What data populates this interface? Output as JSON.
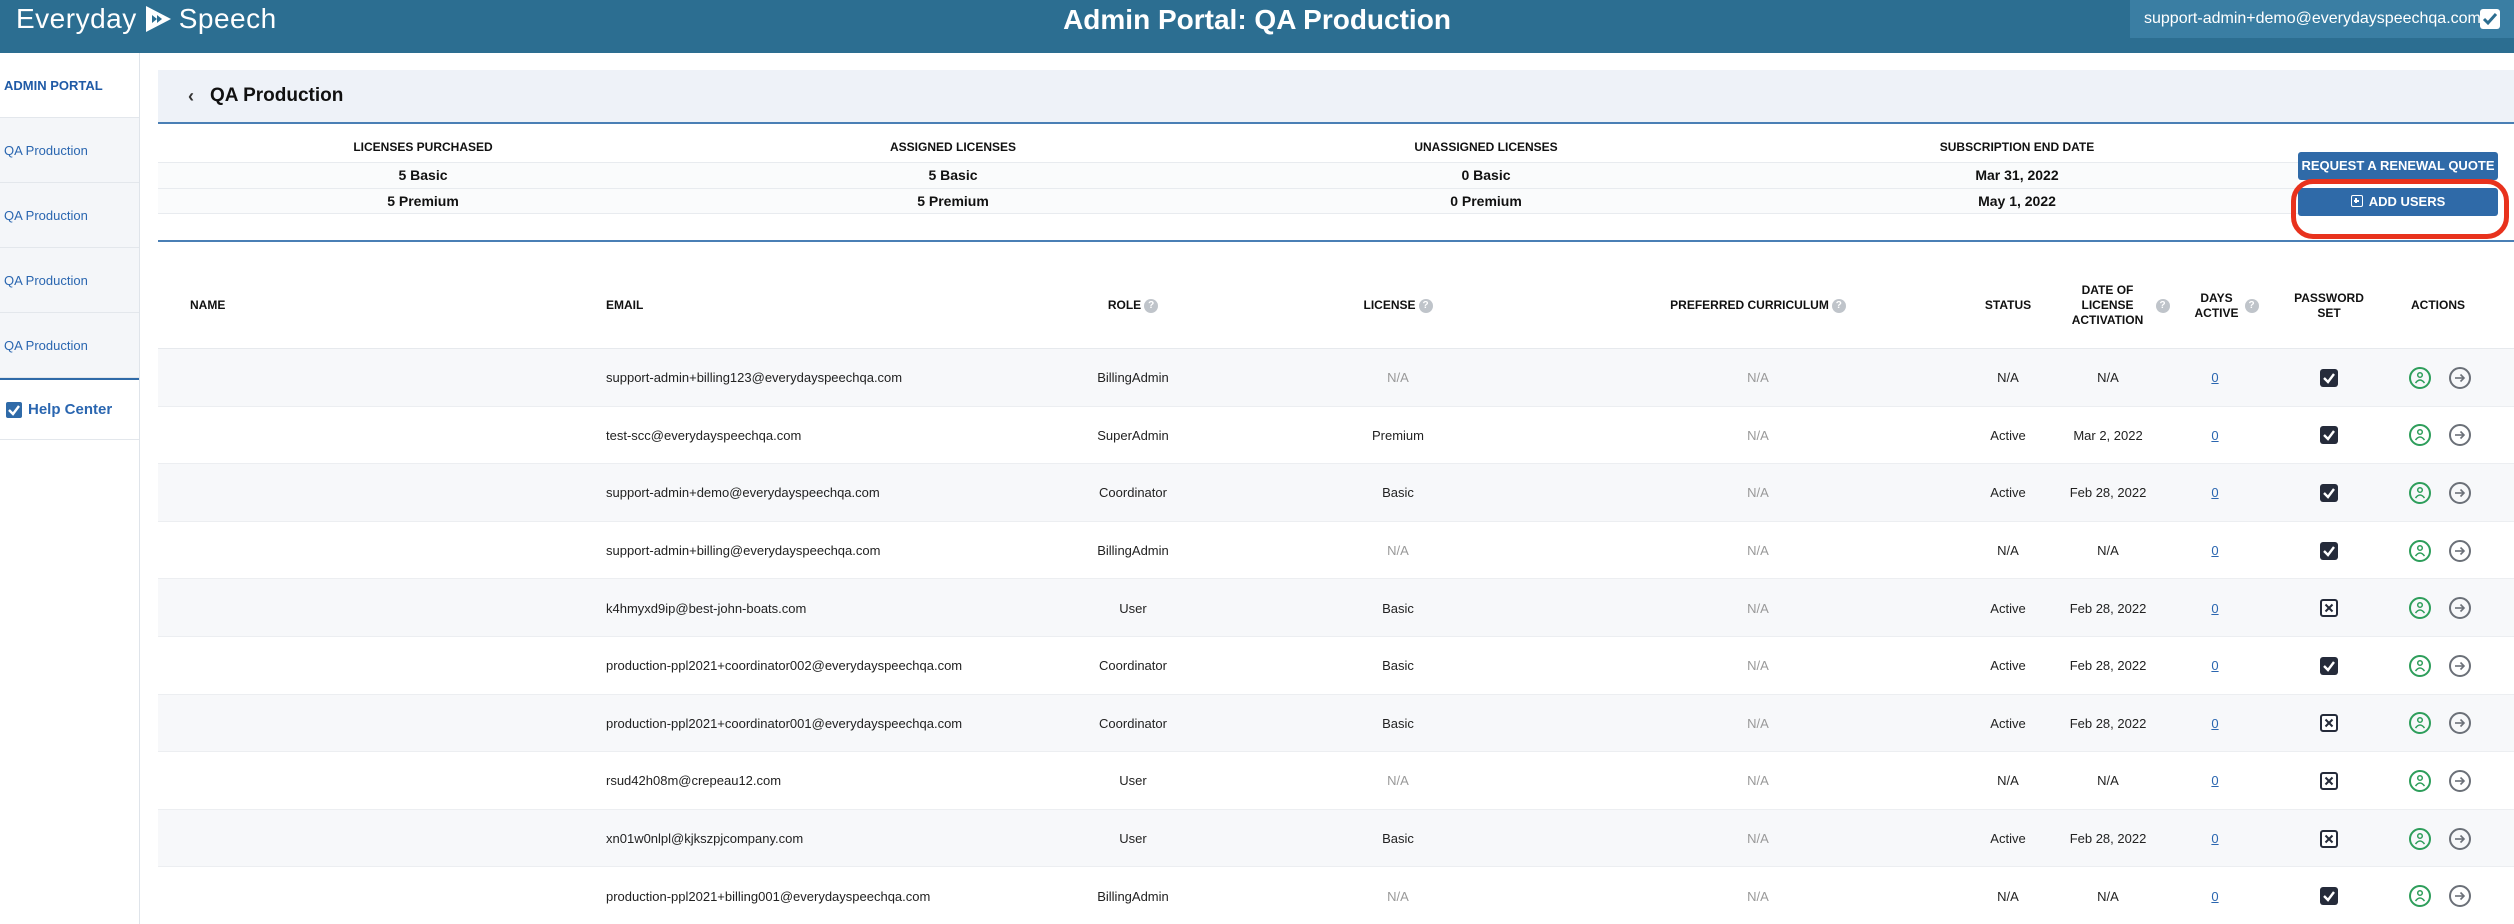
{
  "header": {
    "logo_left": "Everyday",
    "logo_right": "Speech",
    "title": "Admin Portal: QA Production",
    "user_email": "support-admin+demo@everydayspeechqa.com"
  },
  "sidebar": {
    "items": [
      {
        "label": "ADMIN PORTAL"
      },
      {
        "label": "QA Production"
      },
      {
        "label": "QA Production"
      },
      {
        "label": "QA Production"
      },
      {
        "label": "QA Production"
      }
    ],
    "help": "Help Center"
  },
  "page": {
    "title": "QA Production"
  },
  "summary": {
    "headers": [
      "LICENSES PURCHASED",
      "ASSIGNED LICENSES",
      "UNASSIGNED LICENSES",
      "SUBSCRIPTION END DATE"
    ],
    "row1": [
      "5 Basic",
      "5 Basic",
      "0 Basic",
      "Mar 31, 2022"
    ],
    "row2": [
      "5 Premium",
      "5 Premium",
      "0 Premium",
      "May 1, 2022"
    ],
    "renew_label": "REQUEST A RENEWAL QUOTE",
    "add_label": "ADD USERS"
  },
  "table": {
    "headers": {
      "name": "NAME",
      "email": "EMAIL",
      "role": "ROLE",
      "license": "LICENSE",
      "curriculum": "PREFERRED CURRICULUM",
      "status": "STATUS",
      "activation": "DATE OF LICENSE ACTIVATION",
      "days": "DAYS ACTIVE",
      "password": "PASSWORD SET",
      "actions": "ACTIONS",
      "help_mark": "?"
    },
    "rows": [
      {
        "email": "support-admin+billing123@everydayspeechqa.com",
        "role": "BillingAdmin",
        "license": "N/A",
        "curriculum": "N/A",
        "status": "N/A",
        "activation": "N/A",
        "days": "0",
        "password": true
      },
      {
        "email": "test-scc@everydayspeechqa.com",
        "role": "SuperAdmin",
        "license": "Premium",
        "curriculum": "N/A",
        "status": "Active",
        "activation": "Mar 2, 2022",
        "days": "0",
        "password": true
      },
      {
        "email": "support-admin+demo@everydayspeechqa.com",
        "role": "Coordinator",
        "license": "Basic",
        "curriculum": "N/A",
        "status": "Active",
        "activation": "Feb 28, 2022",
        "days": "0",
        "password": true
      },
      {
        "email": "support-admin+billing@everydayspeechqa.com",
        "role": "BillingAdmin",
        "license": "N/A",
        "curriculum": "N/A",
        "status": "N/A",
        "activation": "N/A",
        "days": "0",
        "password": true
      },
      {
        "email": "k4hmyxd9ip@best-john-boats.com",
        "role": "User",
        "license": "Basic",
        "curriculum": "N/A",
        "status": "Active",
        "activation": "Feb 28, 2022",
        "days": "0",
        "password": false
      },
      {
        "email": "production-ppl2021+coordinator002@everydayspeechqa.com",
        "role": "Coordinator",
        "license": "Basic",
        "curriculum": "N/A",
        "status": "Active",
        "activation": "Feb 28, 2022",
        "days": "0",
        "password": true
      },
      {
        "email": "production-ppl2021+coordinator001@everydayspeechqa.com",
        "role": "Coordinator",
        "license": "Basic",
        "curriculum": "N/A",
        "status": "Active",
        "activation": "Feb 28, 2022",
        "days": "0",
        "password": false
      },
      {
        "email": "rsud42h08m@crepeau12.com",
        "role": "User",
        "license": "N/A",
        "curriculum": "N/A",
        "status": "N/A",
        "activation": "N/A",
        "days": "0",
        "password": false
      },
      {
        "email": "xn01w0nlpl@kjkszpjcompany.com",
        "role": "User",
        "license": "Basic",
        "curriculum": "N/A",
        "status": "Active",
        "activation": "Feb 28, 2022",
        "days": "0",
        "password": false
      },
      {
        "email": "production-ppl2021+billing001@everydayspeechqa.com",
        "role": "BillingAdmin",
        "license": "N/A",
        "curriculum": "N/A",
        "status": "N/A",
        "activation": "N/A",
        "days": "0",
        "password": true
      }
    ]
  },
  "icons": {
    "logo": "play-icon",
    "user_menu": "dropdown-check-icon",
    "help": "checkbox-icon",
    "back": "chevron-left-icon",
    "add": "plus-square-icon",
    "row_login": "login-as-user-icon",
    "row_go": "arrow-right-circle-icon"
  },
  "colors": {
    "header_bg": "#2c6e91",
    "accent": "#2f6aa8",
    "highlight": "#e8321d",
    "action_green": "#2e9e5b"
  }
}
